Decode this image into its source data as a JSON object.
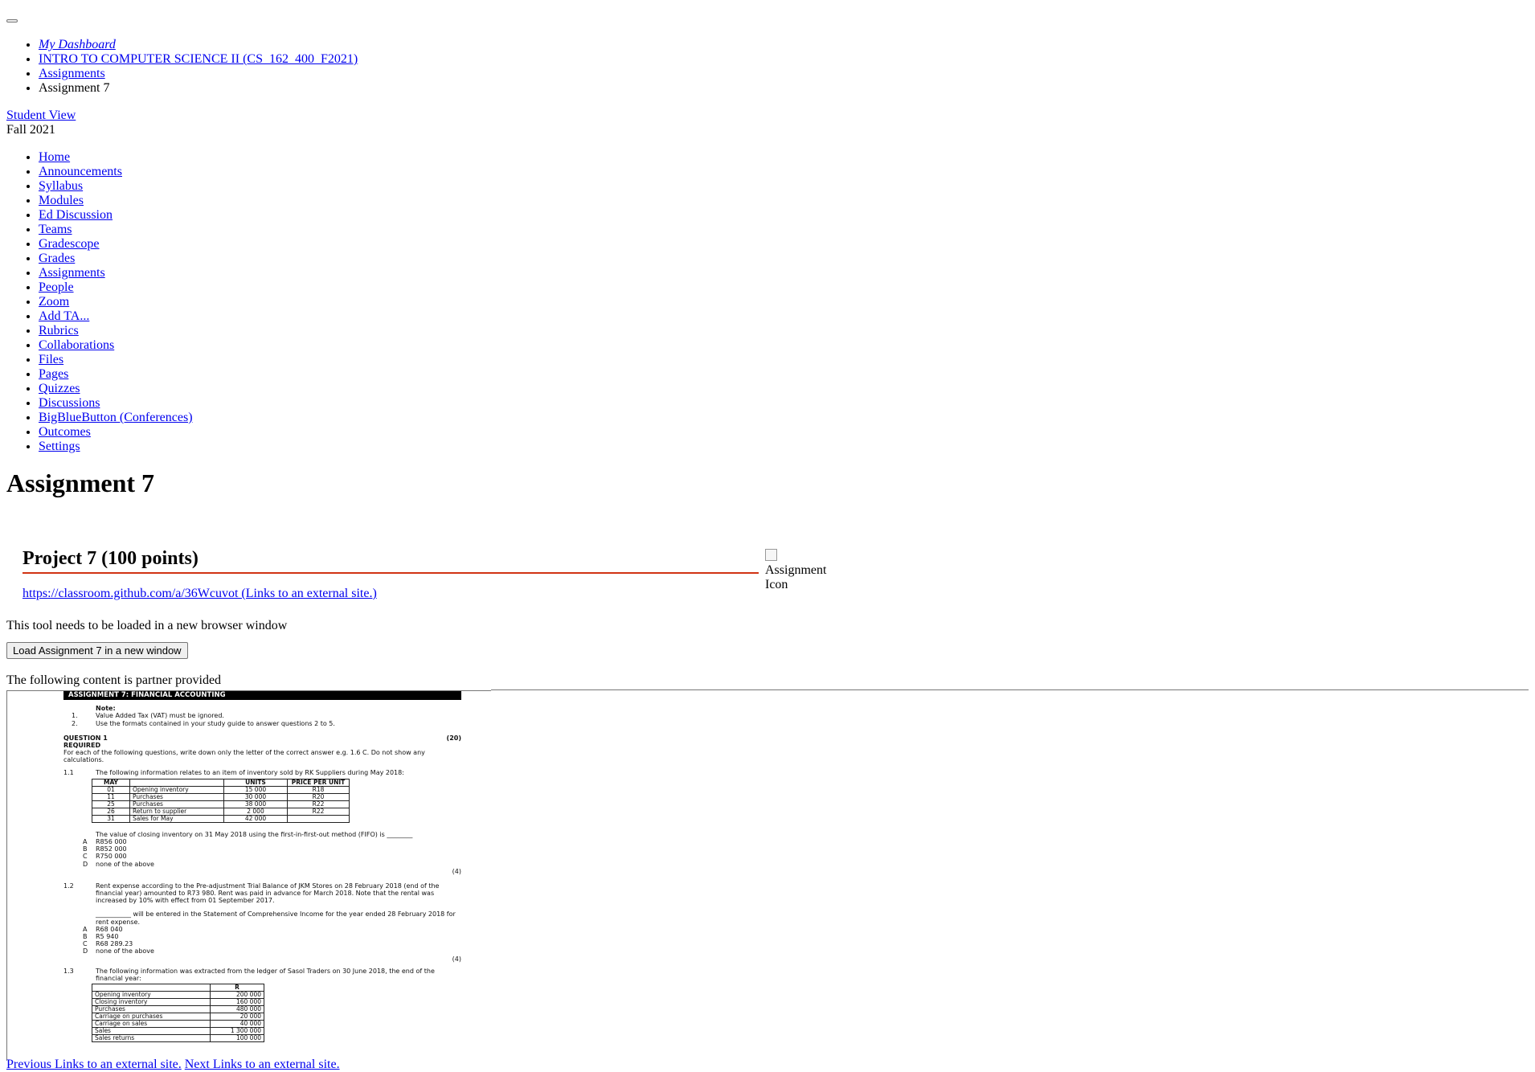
{
  "menu_button": {
    "label": ""
  },
  "breadcrumbs": [
    {
      "label": "My Dashboard"
    },
    {
      "label": "INTRO TO COMPUTER SCIENCE II (CS_162_400_F2021)"
    },
    {
      "label": "Assignments"
    },
    {
      "label": "Assignment 7"
    }
  ],
  "student_view": "Student View",
  "term": "Fall 2021",
  "course_nav": [
    "Home",
    "Announcements",
    "Syllabus",
    "Modules",
    "Ed Discussion",
    "Teams",
    "Gradescope",
    "Grades",
    "Assignments",
    "People",
    "Zoom",
    "Add TA...",
    "Rubrics",
    "Collaborations",
    "Files",
    "Pages",
    "Quizzes",
    "Discussions",
    "BigBlueButton (Conferences)",
    "Outcomes",
    "Settings"
  ],
  "page_title": "Assignment 7",
  "project": {
    "title": "Project 7 (100 points)",
    "link_text": "https://classroom.github.com/a/36Wcuvot (Links to an external site.)",
    "icon_alt": "Assignment Icon"
  },
  "tool_note": "This tool needs to be loaded in a new browser window",
  "load_button": "Load Assignment 7 in a new window",
  "partner_note": "The following content is partner provided",
  "document": {
    "banner": "ASSIGNMENT 7: FINANCIAL ACCOUNTING",
    "note_label": "Note:",
    "notes": [
      {
        "num": "1.",
        "text": "Value Added Tax (VAT) must be ignored."
      },
      {
        "num": "2.",
        "text": "Use the formats contained in your study guide to answer questions 2 to 5."
      }
    ],
    "q1_label": "QUESTION 1",
    "q1_marks": "(20)",
    "required": "REQUIRED",
    "instructions": "For each of the following questions, write down only the letter of the correct answer e.g. 1.6 C.  Do not show any calculations.",
    "q11": {
      "num": "1.1",
      "text": "The following information relates to an item of inventory sold by RK Suppliers during May 2018:",
      "headers": [
        "MAY",
        "",
        "UNITS",
        "PRICE PER UNIT"
      ],
      "rows": [
        [
          "01",
          "Opening inventory",
          "15 000",
          "R18"
        ],
        [
          "11",
          "Purchases",
          "30 000",
          "R20"
        ],
        [
          "25",
          "Purchases",
          "38 000",
          "R22"
        ],
        [
          "26",
          "Return to supplier",
          "2 000",
          "R22"
        ],
        [
          "31",
          "Sales for May",
          "42 000",
          ""
        ]
      ],
      "question": "The value of closing inventory on 31 May 2018 using the first-in-first-out method (FIFO) is ________",
      "options": [
        {
          "letter": "A",
          "text": "R856 000"
        },
        {
          "letter": "B",
          "text": "R852 000"
        },
        {
          "letter": "C",
          "text": "R750 000"
        },
        {
          "letter": "D",
          "text": "none of the above"
        }
      ],
      "marks": "(4)"
    },
    "q12": {
      "num": "1.2",
      "text": "Rent expense according to the Pre-adjustment Trial Balance of JKM Stores on 28 February 2018 (end of the financial year) amounted to R73 980.  Rent was paid in advance for March 2018.  Note that the rental was increased by 10% with effect from 01 September 2017.",
      "question": "___________ will be entered in the Statement of Comprehensive Income for the year ended 28 February 2018 for rent expense.",
      "options": [
        {
          "letter": "A",
          "text": "R68 040"
        },
        {
          "letter": "B",
          "text": "R5 940"
        },
        {
          "letter": "C",
          "text": "R68 289.23"
        },
        {
          "letter": "D",
          "text": "none of the above"
        }
      ],
      "marks": "(4)"
    },
    "q13": {
      "num": "1.3",
      "text": "The following information was extracted from the ledger of Sasol Traders on 30 June 2018, the end of the financial year:",
      "col_header": "R",
      "rows": [
        [
          "Opening inventory",
          "200 000"
        ],
        [
          "Closing inventory",
          "160 000"
        ],
        [
          "Purchases",
          "480 000"
        ],
        [
          "Carriage on purchases",
          "20 000"
        ],
        [
          "Carriage on sales",
          "40 000"
        ],
        [
          "Sales",
          "1 300 000"
        ],
        [
          "Sales returns",
          "100 000"
        ]
      ]
    }
  },
  "pager": {
    "previous": "Previous Links to an external site.",
    "next": "Next Links to an external site."
  }
}
